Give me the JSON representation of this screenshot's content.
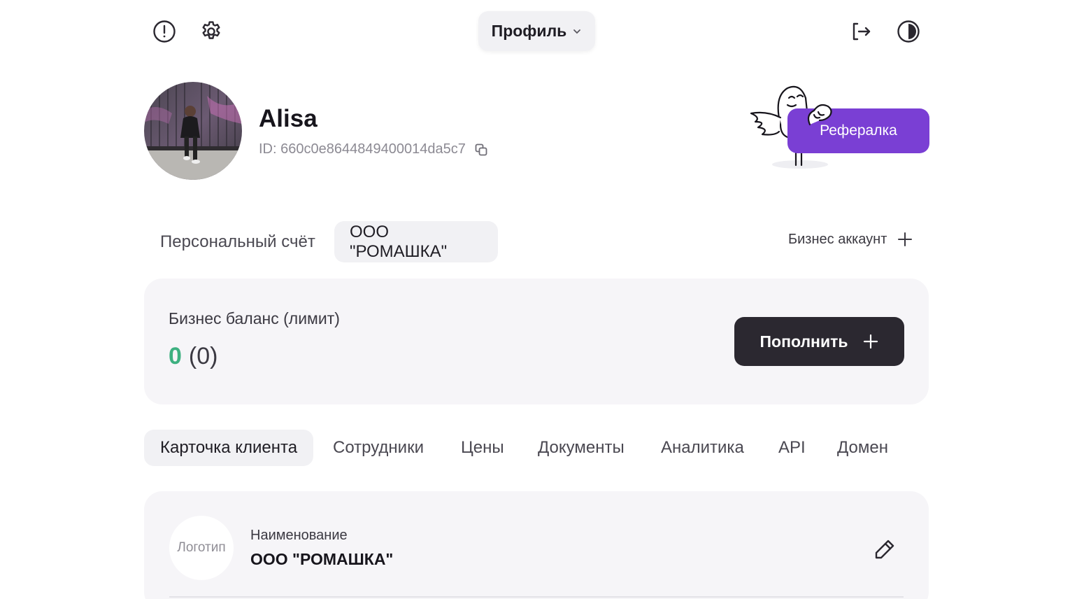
{
  "header": {
    "profile_menu_label": "Профиль",
    "icons": [
      "alert-circle-icon",
      "gear-icon",
      "logout-icon",
      "theme-toggle-icon"
    ]
  },
  "user": {
    "name": "Alisa",
    "id_text": "ID: 660c0e8644849400014da5c7"
  },
  "referral": {
    "label": "Рефералка",
    "accent": "#7a3fd4"
  },
  "accounts": {
    "tabs": [
      "Персональный счёт",
      "ООО \"РОМАШКА\""
    ],
    "active_index": 1,
    "add_business_label": "Бизнес аккаунт"
  },
  "balance": {
    "title": "Бизнес баланс (лимит)",
    "value": "0",
    "limit": "(0)",
    "value_color": "#3db080",
    "topup_label": "Пополнить"
  },
  "sections": {
    "tabs": [
      "Карточка клиента",
      "Сотрудники",
      "Цены",
      "Документы",
      "Аналитика",
      "API",
      "Домен"
    ],
    "active_index": 0
  },
  "client_card": {
    "logo_placeholder": "Логотип",
    "name_label": "Наименование",
    "name_value": "ООО \"РОМАШКА\""
  }
}
